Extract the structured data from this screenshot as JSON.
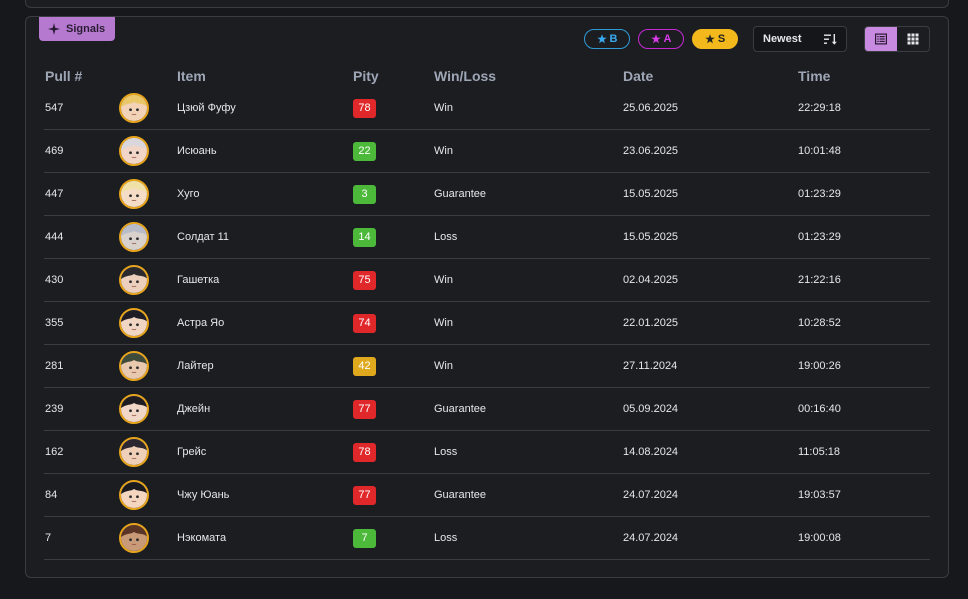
{
  "tag": {
    "label": "Signals",
    "icon": "sparkle-icon"
  },
  "filters": [
    {
      "rank": "B",
      "icon": "star-icon",
      "color": "#38a9ef"
    },
    {
      "rank": "A",
      "icon": "star-icon",
      "color": "#d83bea"
    },
    {
      "rank": "S",
      "icon": "star-icon",
      "color": "#f2b81c"
    }
  ],
  "sort": {
    "label": "Newest",
    "icon": "sort-descending-icon"
  },
  "view_toggle": {
    "list_icon": "list-view-icon",
    "grid_icon": "grid-view-icon",
    "active": "list"
  },
  "colors": {
    "pity_red": "#e0282b",
    "pity_green": "#4cb93a",
    "pity_yellow": "#e0a91d",
    "avatar_border": "#e8a51c",
    "accent": "#c889e0"
  },
  "table": {
    "headers": {
      "pull": "Pull #",
      "item": "Item",
      "pity": "Pity",
      "result": "Win/Loss",
      "date": "Date",
      "time": "Time"
    },
    "rows": [
      {
        "pull": "547",
        "item": "Цзюй Фуфу",
        "pity": "78",
        "pity_color": "red",
        "result": "Win",
        "date": "25.06.2025",
        "time": "22:29:18",
        "avatar": "character-avatar-icon"
      },
      {
        "pull": "469",
        "item": "Исюань",
        "pity": "22",
        "pity_color": "green",
        "result": "Win",
        "date": "23.06.2025",
        "time": "10:01:48",
        "avatar": "character-avatar-icon"
      },
      {
        "pull": "447",
        "item": "Хуго",
        "pity": "3",
        "pity_color": "green",
        "result": "Guarantee",
        "date": "15.05.2025",
        "time": "01:23:29",
        "avatar": "character-avatar-icon"
      },
      {
        "pull": "444",
        "item": "Солдат 11",
        "pity": "14",
        "pity_color": "green",
        "result": "Loss",
        "date": "15.05.2025",
        "time": "01:23:29",
        "avatar": "character-avatar-icon"
      },
      {
        "pull": "430",
        "item": "Гашетка",
        "pity": "75",
        "pity_color": "red",
        "result": "Win",
        "date": "02.04.2025",
        "time": "21:22:16",
        "avatar": "character-avatar-icon"
      },
      {
        "pull": "355",
        "item": "Астра Яо",
        "pity": "74",
        "pity_color": "red",
        "result": "Win",
        "date": "22.01.2025",
        "time": "10:28:52",
        "avatar": "character-avatar-icon"
      },
      {
        "pull": "281",
        "item": "Лайтер",
        "pity": "42",
        "pity_color": "yellow",
        "result": "Win",
        "date": "27.11.2024",
        "time": "19:00:26",
        "avatar": "character-avatar-icon"
      },
      {
        "pull": "239",
        "item": "Джейн",
        "pity": "77",
        "pity_color": "red",
        "result": "Guarantee",
        "date": "05.09.2024",
        "time": "00:16:40",
        "avatar": "character-avatar-icon"
      },
      {
        "pull": "162",
        "item": "Грейс",
        "pity": "78",
        "pity_color": "red",
        "result": "Loss",
        "date": "14.08.2024",
        "time": "11:05:18",
        "avatar": "character-avatar-icon"
      },
      {
        "pull": "84",
        "item": "Чжу Юань",
        "pity": "77",
        "pity_color": "red",
        "result": "Guarantee",
        "date": "24.07.2024",
        "time": "19:03:57",
        "avatar": "character-avatar-icon"
      },
      {
        "pull": "7",
        "item": "Нэкомата",
        "pity": "7",
        "pity_color": "green",
        "result": "Loss",
        "date": "24.07.2024",
        "time": "19:00:08",
        "avatar": "character-avatar-icon"
      }
    ]
  }
}
